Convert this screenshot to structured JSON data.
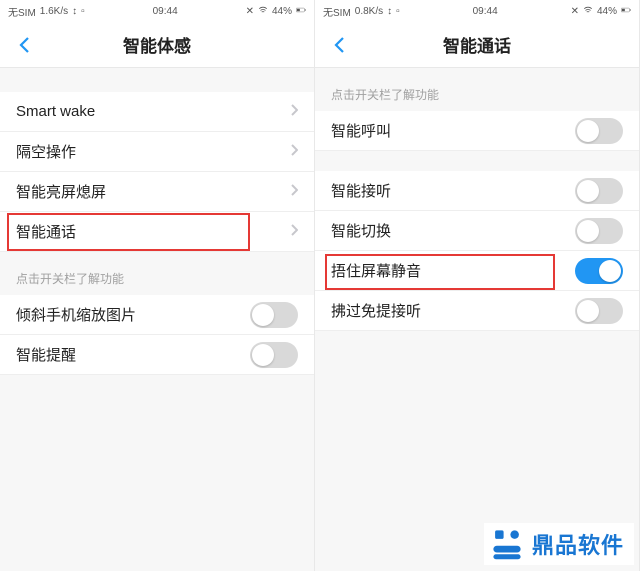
{
  "left": {
    "status": {
      "sim": "无SIM",
      "speed": "1.6K/s",
      "time": "09:44",
      "battery": "44%"
    },
    "title": "智能体感",
    "rows": [
      {
        "label": "Smart wake",
        "type": "nav"
      },
      {
        "label": "隔空操作",
        "type": "nav"
      },
      {
        "label": "智能亮屏熄屏",
        "type": "nav"
      },
      {
        "label": "智能通话",
        "type": "nav",
        "highlight": true
      }
    ],
    "hint": "点击开关栏了解功能",
    "rows2": [
      {
        "label": "倾斜手机缩放图片",
        "type": "toggle",
        "on": false
      },
      {
        "label": "智能提醒",
        "type": "toggle",
        "on": false
      }
    ]
  },
  "right": {
    "status": {
      "sim": "无SIM",
      "speed": "0.8K/s",
      "time": "09:44",
      "battery": "44%"
    },
    "title": "智能通话",
    "hint": "点击开关栏了解功能",
    "rows": [
      {
        "label": "智能呼叫",
        "type": "toggle",
        "on": false
      },
      {
        "label": "智能接听",
        "type": "toggle",
        "on": false
      },
      {
        "label": "智能切换",
        "type": "toggle",
        "on": false
      },
      {
        "label": "捂住屏幕静音",
        "type": "toggle",
        "on": true,
        "highlight": true
      },
      {
        "label": "拂过免提接听",
        "type": "toggle",
        "on": false
      }
    ]
  },
  "watermark": "鼎品软件"
}
